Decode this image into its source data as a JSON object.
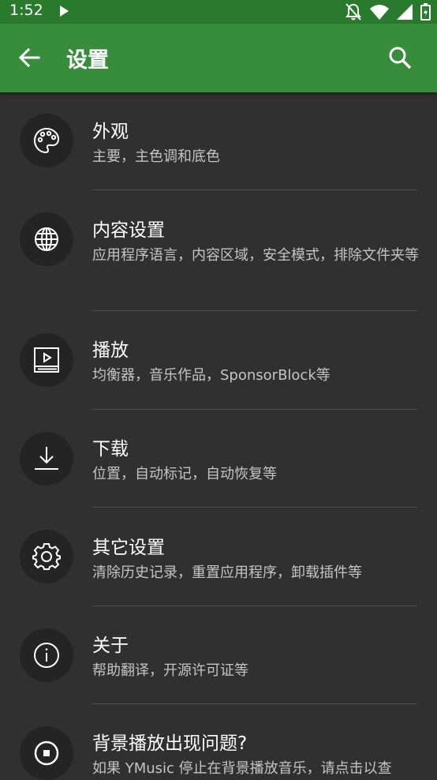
{
  "status_bar": {
    "time": "1:52",
    "icons": [
      "play-icon",
      "notifications-off-icon",
      "wifi-icon",
      "signal-icon",
      "battery-icon"
    ]
  },
  "app_bar": {
    "title": "设置",
    "back_icon": "back-arrow-icon",
    "search_icon": "search-icon",
    "color": "#378d3b",
    "status_color": "#2a7a2e"
  },
  "settings": [
    {
      "icon": "palette-icon",
      "title": "外观",
      "subtitle": "主要，主色调和底色"
    },
    {
      "icon": "globe-icon",
      "title": "内容设置",
      "subtitle": "应用程序语言，内容区域，安全模式，排除文件夹等"
    },
    {
      "icon": "player-icon",
      "title": "播放",
      "subtitle": "均衡器，音乐作品，SponsorBlock等"
    },
    {
      "icon": "download-icon",
      "title": "下载",
      "subtitle": "位置，自动标记，自动恢复等"
    },
    {
      "icon": "gear-icon",
      "title": "其它设置",
      "subtitle": "清除历史记录，重置应用程序，卸载插件等"
    },
    {
      "icon": "info-icon",
      "title": "关于",
      "subtitle": "帮助翻译，开源许可证等"
    },
    {
      "icon": "stop-icon",
      "title": "背景播放出现问题?",
      "subtitle": "如果 YMusic 停止在背景播放音乐，请点击以查"
    }
  ]
}
